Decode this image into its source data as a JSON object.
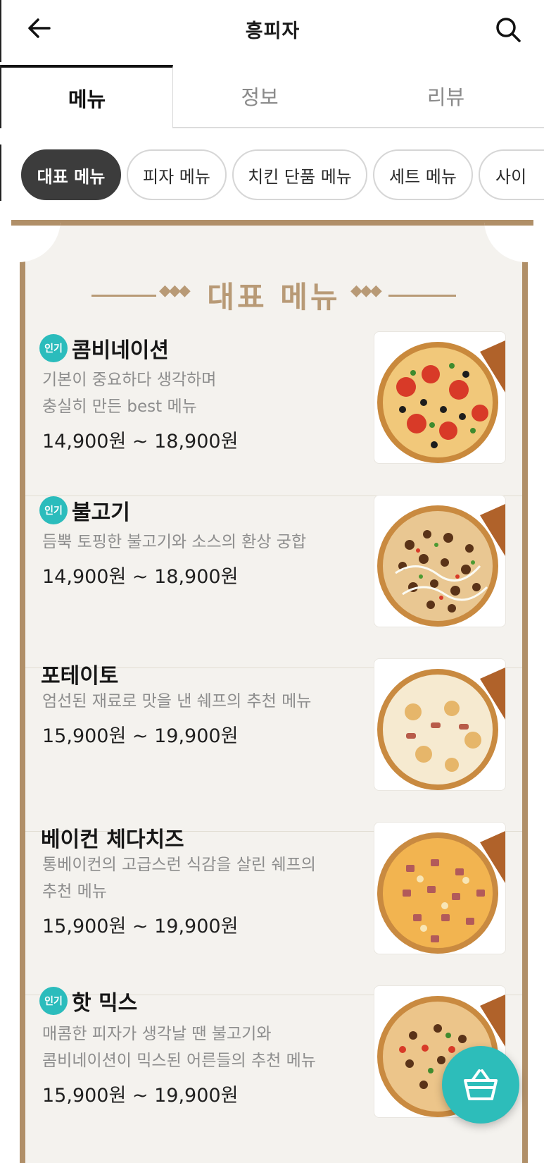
{
  "header": {
    "title": "흥피자",
    "back_icon": "arrow-left-icon",
    "search_icon": "search-icon"
  },
  "tabs": [
    {
      "label": "메뉴",
      "active": true
    },
    {
      "label": "정보",
      "active": false
    },
    {
      "label": "리뷰",
      "active": false
    }
  ],
  "chips": [
    {
      "label": "대표 메뉴",
      "active": true
    },
    {
      "label": "피자 메뉴",
      "active": false
    },
    {
      "label": "치킨 단품 메뉴",
      "active": false
    },
    {
      "label": "세트 메뉴",
      "active": false
    },
    {
      "label": "사이",
      "active": false
    }
  ],
  "section": {
    "title": "대표 메뉴"
  },
  "badge_label": "인기",
  "items": [
    {
      "name": "콤비네이션",
      "popular": true,
      "desc": [
        "기본이 중요하다 생각하며",
        "충실히 만든 best 메뉴"
      ],
      "price": "14,900원 ~ 18,900원"
    },
    {
      "name": "불고기",
      "popular": true,
      "desc": [
        "듬뿍 토핑한 불고기와 소스의 환상 궁합"
      ],
      "price": "14,900원 ~ 18,900원"
    },
    {
      "name": "포테이토",
      "popular": false,
      "desc": [
        "엄선된 재료로 맛을 낸 쉐프의 추천 메뉴"
      ],
      "price": "15,900원 ~ 19,900원"
    },
    {
      "name": "베이컨 체다치즈",
      "popular": false,
      "desc": [
        "통베이컨의 고급스런 식감을 살린 쉐프의",
        "추천 메뉴"
      ],
      "price": "15,900원 ~ 19,900원"
    },
    {
      "name": "핫 믹스",
      "popular": true,
      "desc": [
        "매콤한 피자가 생각날 땐 불고기와",
        "콤비네이션이 믹스된 어른들의 추천 메뉴"
      ],
      "price": "15,900원 ~ 19,900원"
    }
  ],
  "colors": {
    "accent": "#2bbcbc",
    "frame": "#b08f68",
    "section_title": "#b89a76",
    "chip_active": "#3c3c3c"
  },
  "cart_icon": "basket-icon"
}
